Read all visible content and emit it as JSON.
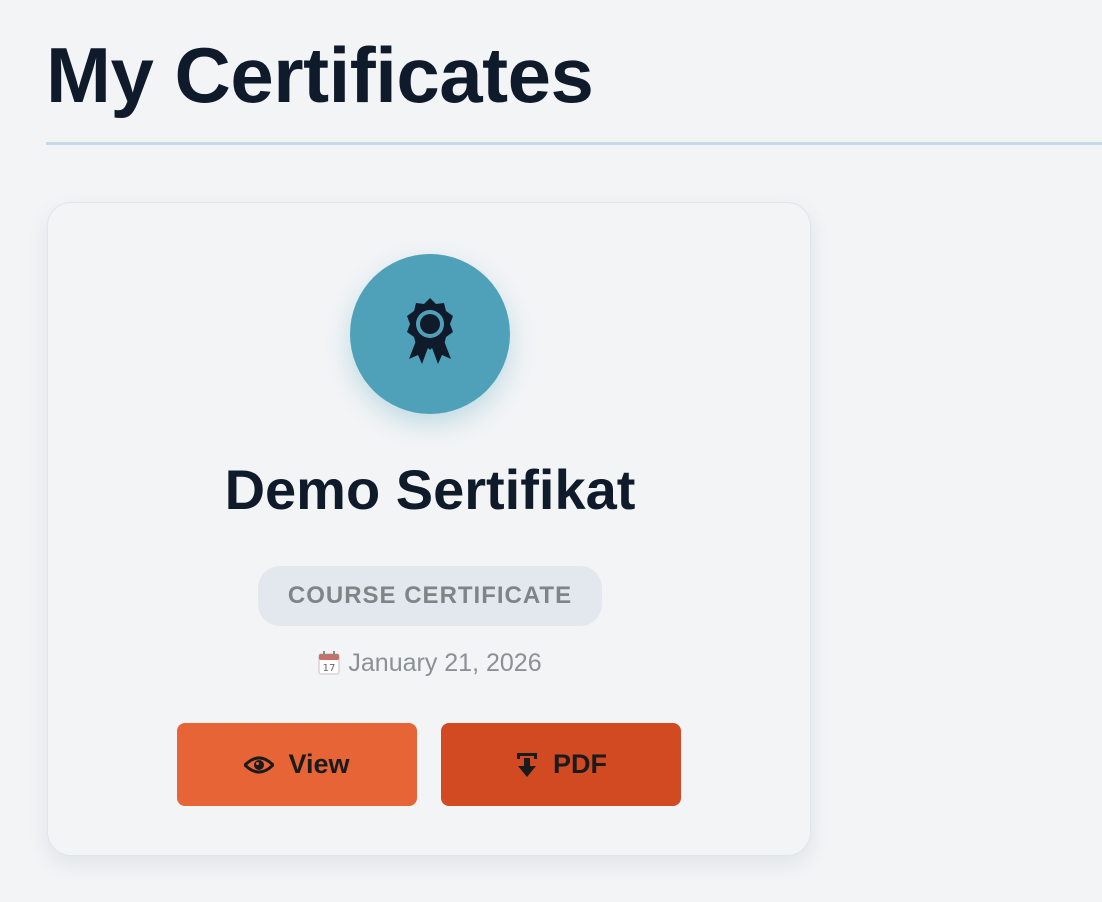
{
  "page": {
    "title": "My Certificates"
  },
  "certificate": {
    "title": "Demo Sertifikat",
    "type_label": "COURSE CERTIFICATE",
    "date": "January 21, 2026",
    "date_icon": "calendar-icon",
    "icon": "award-ribbon-icon",
    "icon_circle_color": "#4fa1ba"
  },
  "actions": {
    "view_label": "View",
    "view_icon": "eye-icon",
    "view_color": "#e76436",
    "pdf_label": "PDF",
    "pdf_icon": "download-icon",
    "pdf_color": "#d24a22"
  }
}
